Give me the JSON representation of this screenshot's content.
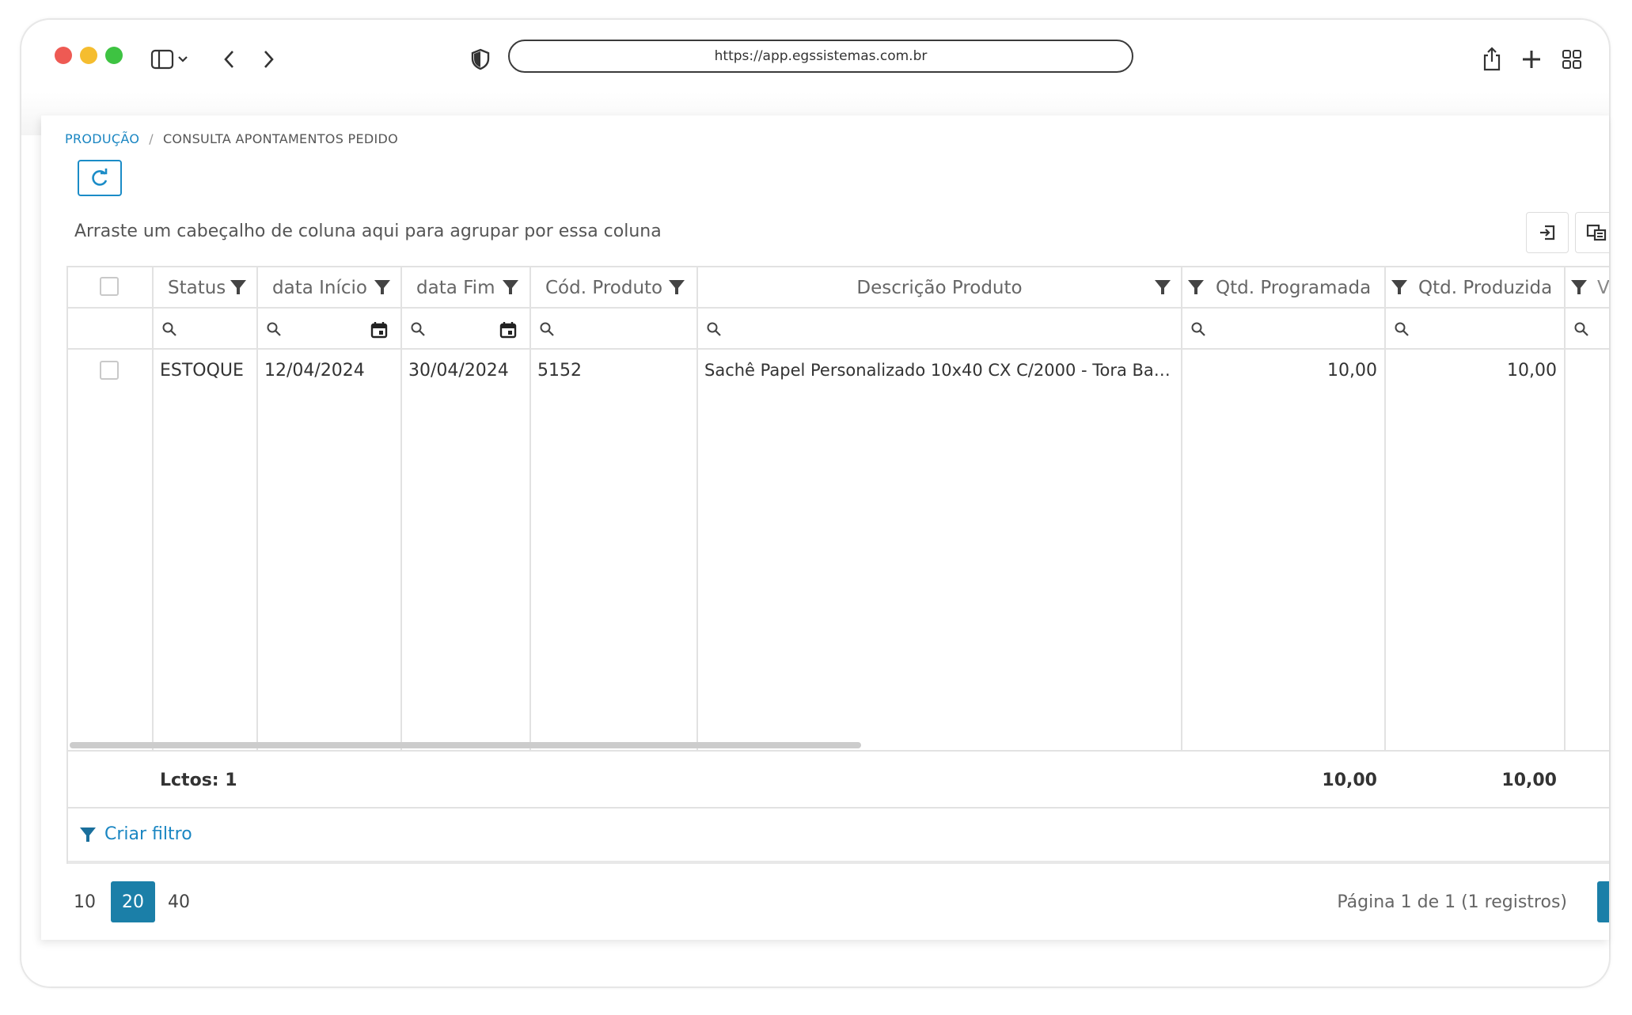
{
  "browser": {
    "url": "https://app.egssistemas.com.br"
  },
  "breadcrumb": {
    "parent": "PRODUÇÃO",
    "separator": "/",
    "current": "CONSULTA APONTAMENTOS PEDIDO"
  },
  "grid": {
    "group_hint": "Arraste um cabeçalho de coluna aqui para agrupar por essa coluna",
    "columns": {
      "status": "Status",
      "data_inicio": "data Início",
      "data_fim": "data Fim",
      "cod_produto": "Cód. Produto",
      "descricao": "Descrição Produto",
      "qtd_programada": "Qtd. Programada",
      "qtd_produzida": "Qtd. Produzida",
      "truncated": "V"
    },
    "rows": [
      {
        "status": "ESTOQUE",
        "data_inicio": "12/04/2024",
        "data_fim": "30/04/2024",
        "cod_produto": "5152",
        "descricao": "Sachê Papel Personalizado 10x40 CX C/2000 - Tora Bar...",
        "qtd_programada": "10,00",
        "qtd_produzida": "10,00"
      }
    ],
    "footer": {
      "count": "Lctos: 1",
      "sum_programada": "10,00",
      "sum_produzida": "10,00"
    },
    "create_filter": "Criar filtro"
  },
  "pager": {
    "sizes": [
      "10",
      "20",
      "40"
    ],
    "active_size": "20",
    "info": "Página 1 de 1 (1 registros)",
    "current_page": "1"
  },
  "colors": {
    "accent": "#1b7fa8",
    "link": "#1a86c2"
  }
}
